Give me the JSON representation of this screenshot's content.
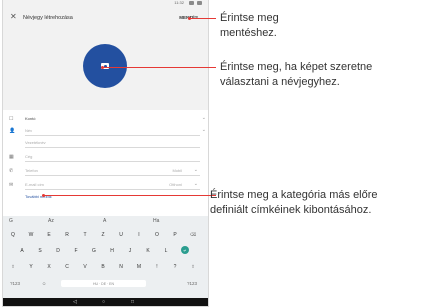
{
  "status_bar": {
    "time": "11:32"
  },
  "app_bar": {
    "title": "Névjegy létrehozása",
    "save_label": "MENTÉS"
  },
  "form": {
    "rows": [
      {
        "icon": "person-icon",
        "label": "Kontó",
        "type": ""
      },
      {
        "icon": "person-icon",
        "label": "Név",
        "type": ""
      },
      {
        "icon": "",
        "label": "Vezetéknév",
        "type": ""
      },
      {
        "icon": "business-icon",
        "label": "Cég",
        "type": ""
      },
      {
        "icon": "phone-icon",
        "label": "Telefon",
        "type": "Mobil"
      },
      {
        "icon": "email-icon",
        "label": "E-mail cím",
        "type": "Otthoni"
      }
    ],
    "more_fields": "További mezők"
  },
  "keyboard": {
    "suggestions": [
      "G",
      "Az",
      "A",
      "Ha"
    ],
    "row1": [
      "Q",
      "W",
      "E",
      "R",
      "T",
      "Z",
      "U",
      "I",
      "O",
      "P",
      "⌫"
    ],
    "row2": [
      "A",
      "S",
      "D",
      "F",
      "G",
      "H",
      "J",
      "K",
      "L",
      "↵"
    ],
    "row3": [
      "⇧",
      "Y",
      "X",
      "C",
      "V",
      "B",
      "N",
      "M",
      "!",
      "?",
      "⇧"
    ],
    "row4": {
      "left": "?123",
      "emoji": "☺",
      "space": "HU · DE · EN",
      "right": "?123"
    }
  },
  "callouts": [
    {
      "text": "Érintse meg\nmentéshez."
    },
    {
      "text": "Érintse meg, ha képet szeretne\nválasztani a névjegyhez."
    },
    {
      "text": "Érintse meg a kategória más előre\ndefiniált címkéinek kibontásához."
    }
  ]
}
